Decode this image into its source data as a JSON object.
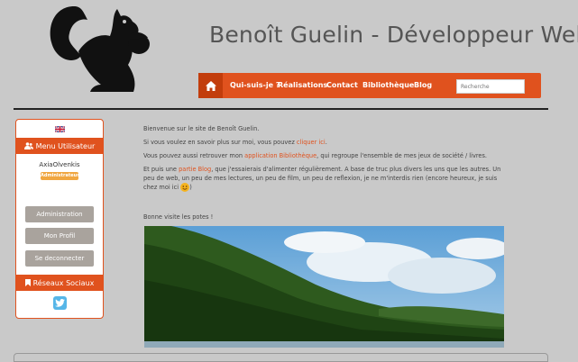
{
  "header": {
    "title": "Benoît Guelin - Développeur Web",
    "logo_icon": "squirrel-logo-icon"
  },
  "nav": {
    "home_icon": "home-icon",
    "items": [
      "Qui-suis-je ?",
      "Réalisations",
      "Contact",
      "Bibliothèque",
      "Blog"
    ],
    "search_placeholder": "Recherche"
  },
  "sidebar": {
    "language_flag": "uk-flag-icon",
    "user_panel_title": "Menu Utilisateur",
    "username": "AxiaOlvenkis",
    "role_badge": "Administrateur",
    "buttons": [
      "Administration",
      "Mon Profil",
      "Se deconnecter"
    ],
    "social_panel_title": "Réseaux Sociaux",
    "social_icon": "twitter-icon"
  },
  "content": {
    "welcome": "Bienvenue sur le site de Benoît Guelin.",
    "more_prefix": "Si vous voulez en savoir plus sur moi, vous pouvez ",
    "more_link": "cliquer ici",
    "more_suffix": ".",
    "library_prefix": "Vous pouvez aussi retrouver mon ",
    "library_link": "application Bibliothèque",
    "library_suffix": ", qui regroupe l'ensemble de mes jeux de société / livres.",
    "blog_prefix": "Et puis une ",
    "blog_link": "partie Blog",
    "blog_suffix": ", que j'essaierais d'alimenter régulièrement. A base de truc plus divers les uns que les autres. Un peu de web, un peu de mes lectures, un peu de film, un peu de reflexion, je ne m'interdis rien (encore heureux, je suis chez moi ici ",
    "blog_end": ")",
    "goodbye": "Bonne visite les potes !"
  },
  "colors": {
    "accent": "#e0521e",
    "background": "#c9c9c9",
    "button_gray": "#a9a39d",
    "badge": "#f0a640"
  }
}
